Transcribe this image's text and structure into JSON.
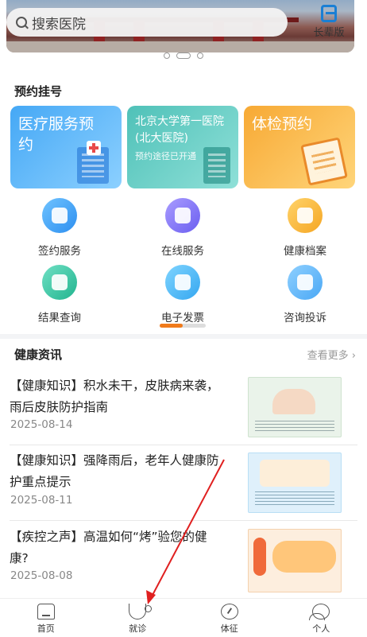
{
  "search": {
    "placeholder": "搜索医院"
  },
  "header": {
    "elder_mode_label": "长辈版"
  },
  "booking": {
    "title": "预约挂号",
    "cards": [
      {
        "title": "医疗服务预约",
        "subtitle": ""
      },
      {
        "title": "北京大学第一医院(北大医院)",
        "subtitle": "预约途径已开通"
      },
      {
        "title": "体检预约",
        "subtitle": ""
      }
    ]
  },
  "services": {
    "items": [
      {
        "label": "签约服务",
        "icon": "handshake-icon"
      },
      {
        "label": "在线服务",
        "icon": "doctor-icon"
      },
      {
        "label": "健康档案",
        "icon": "folder-plus-icon"
      },
      {
        "label": "结果查询",
        "icon": "magnifier-plus-icon"
      },
      {
        "label": "电子发票",
        "icon": "printer-icon"
      },
      {
        "label": "咨询投诉",
        "icon": "bag-smile-icon"
      }
    ],
    "page_progress": 0.5
  },
  "news": {
    "title": "健康资讯",
    "more": "查看更多",
    "items": [
      {
        "title": "【健康知识】积水未干，皮肤病来袭，雨后皮肤防护指南",
        "date": "2025-08-14"
      },
      {
        "title": "【健康知识】强降雨后，老年人健康防护重点提示",
        "date": "2025-08-11"
      },
      {
        "title": "【疾控之声】高温如何“烤”验您的健康?",
        "date": "2025-08-08"
      }
    ]
  },
  "thumb_texts": {
    "thumb2_heading": "强降雨后 老年人健康防护 重点提示"
  },
  "tabbar": {
    "items": [
      {
        "label": "首页",
        "icon": "home-icon"
      },
      {
        "label": "就诊",
        "icon": "stethoscope-icon"
      },
      {
        "label": "体征",
        "icon": "gauge-icon"
      },
      {
        "label": "个人",
        "icon": "person-icon"
      }
    ]
  },
  "colors": {
    "accent": "#1a7fd4",
    "pager_active": "#f07a1a",
    "annotation": "#e02020"
  }
}
